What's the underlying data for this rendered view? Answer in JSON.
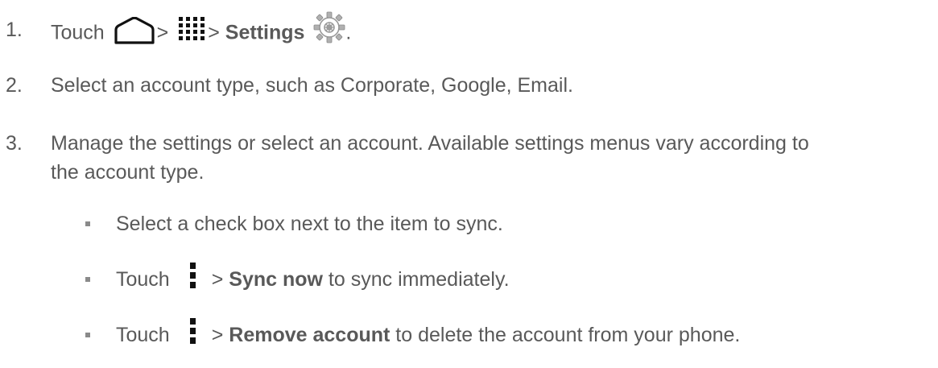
{
  "steps": [
    {
      "number": "1.",
      "touch": "Touch",
      "sep1": ">",
      "sep2": ">",
      "settings": "Settings",
      "end": "."
    },
    {
      "number": "2.",
      "text": "Select an account type, such as Corporate, Google, Email."
    },
    {
      "number": "3.",
      "text_line1": "Manage the settings or select an account. Available settings menus vary according to",
      "text_line2": "the account type."
    }
  ],
  "bullets": [
    {
      "text": "Select a check box next to the item to sync."
    },
    {
      "touch": "Touch",
      "sep": ">",
      "bold": "Sync now",
      "rest": "to sync immediately."
    },
    {
      "touch": "Touch",
      "sep": ">",
      "bold": "Remove account",
      "rest": "to delete the account from your phone."
    }
  ],
  "icons": {
    "home": "home-icon",
    "apps": "apps-grid-icon",
    "settings": "settings-gear-icon",
    "menu": "menu-icon"
  }
}
